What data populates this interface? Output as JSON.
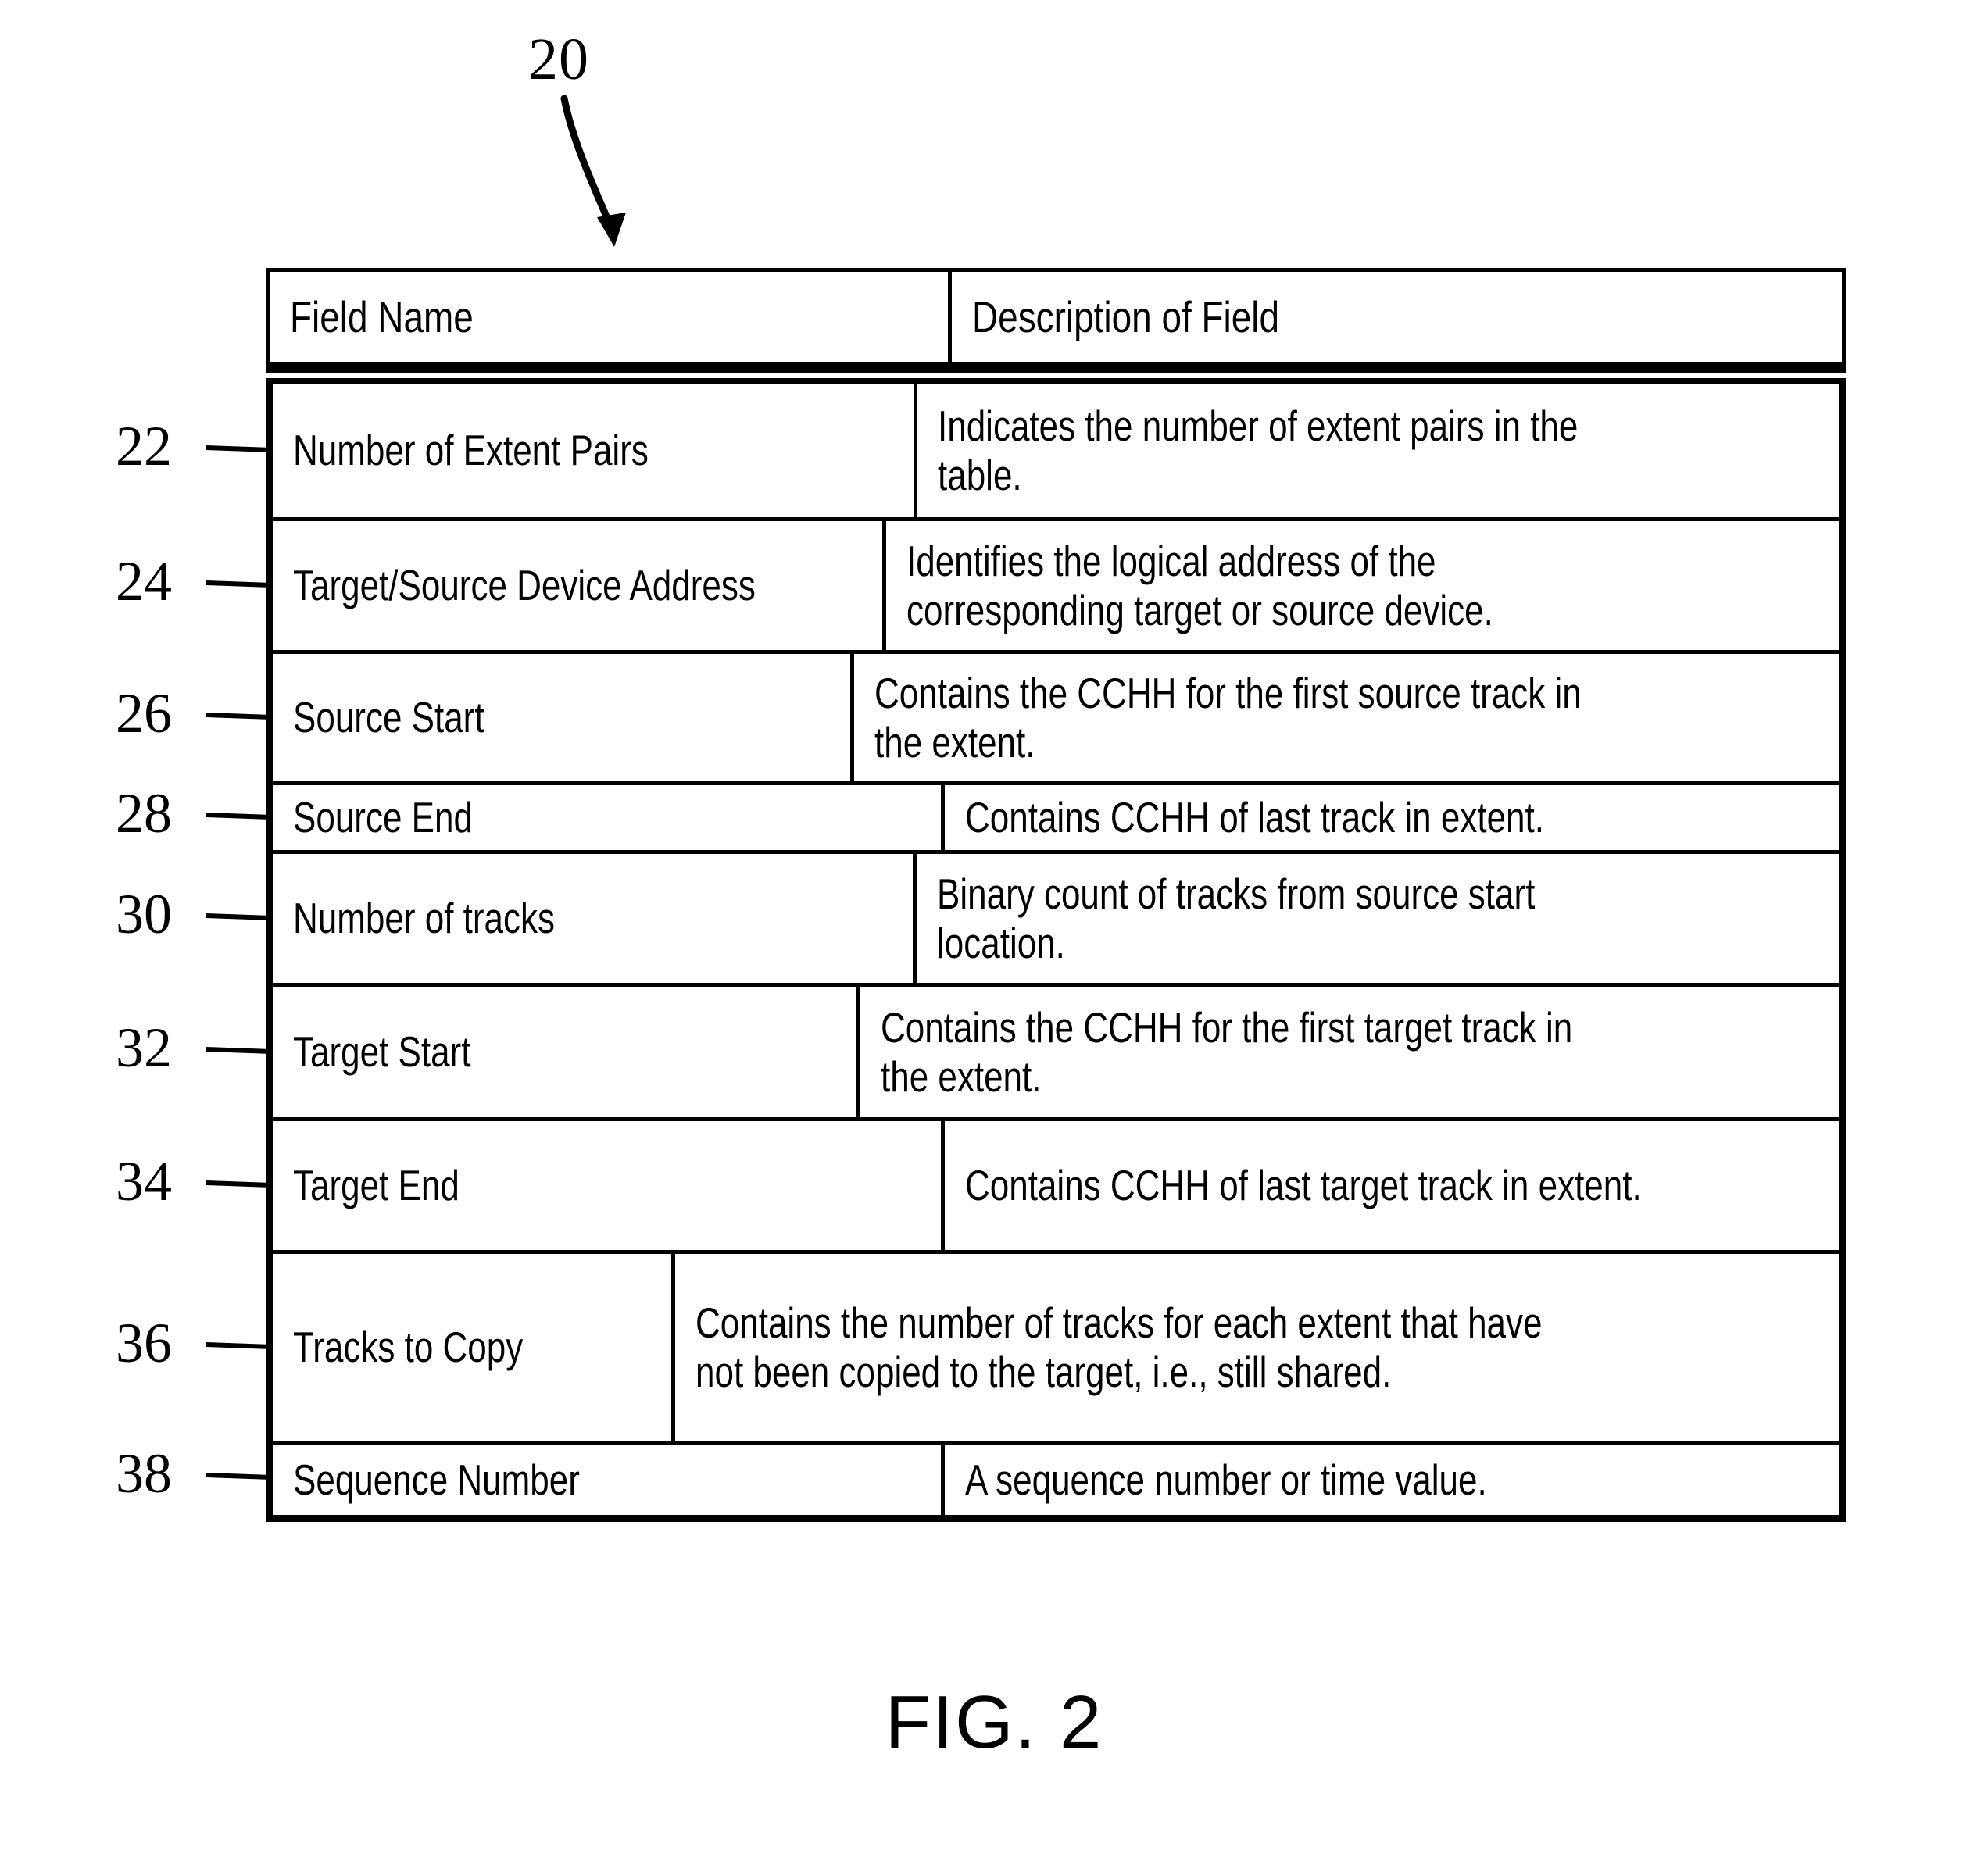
{
  "figure": {
    "number_label": "20",
    "caption": "FIG. 2"
  },
  "table": {
    "columns": [
      {
        "key": "field_name",
        "header": "Field Name"
      },
      {
        "key": "description",
        "header": "Description of Field"
      }
    ],
    "rows": [
      {
        "ref": "22",
        "field_name": "Number of Extent Pairs",
        "description": "Indicates  the number of extent pairs in the table."
      },
      {
        "ref": "24",
        "field_name": "Target/Source Device Address",
        "description": "Identifies the logical address of the corresponding target or source device."
      },
      {
        "ref": "26",
        "field_name": "Source Start",
        "description": "Contains the CCHH for the first source track in the extent."
      },
      {
        "ref": "28",
        "field_name": "Source End",
        "description": "Contains CCHH of last track in extent."
      },
      {
        "ref": "30",
        "field_name": "Number of tracks",
        "description": "Binary count of tracks from source start location."
      },
      {
        "ref": "32",
        "field_name": "Target Start",
        "description": "Contains the CCHH for the first target track in the extent."
      },
      {
        "ref": "34",
        "field_name": "Target End",
        "description": "Contains CCHH of last target track in extent."
      },
      {
        "ref": "36",
        "field_name": "Tracks to Copy",
        "description": "Contains the number of tracks for each extent that have not been copied to the target, i.e., still shared."
      },
      {
        "ref": "38",
        "field_name": "Sequence Number",
        "description": "A sequence number or time value."
      }
    ]
  },
  "colors": {
    "ink": "#000000",
    "paper": "#ffffff"
  }
}
